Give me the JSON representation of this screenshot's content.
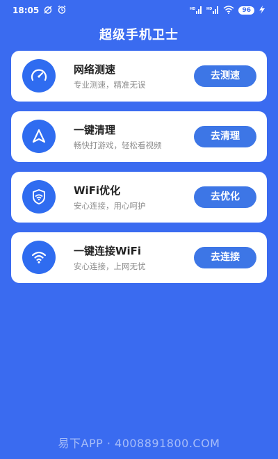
{
  "status_bar": {
    "time": "18:05",
    "icons_left": [
      "alarm-off-icon",
      "alarm-clock-icon"
    ],
    "signal_label": "HD",
    "battery": "96"
  },
  "header": {
    "title": "超级手机卫士"
  },
  "cards": [
    {
      "title": "网络测速",
      "subtitle": "专业测速，精准无误",
      "button": "去测速",
      "icon": "speedometer-icon"
    },
    {
      "title": "一键清理",
      "subtitle": "畅快打游戏，轻松看视频",
      "button": "去清理",
      "icon": "navigation-arrow-icon"
    },
    {
      "title": "WiFi优化",
      "subtitle": "安心连接，用心呵护",
      "button": "去优化",
      "icon": "shield-wifi-icon"
    },
    {
      "title": "一键连接WiFi",
      "subtitle": "安心连接，上网无忧",
      "button": "去连接",
      "icon": "wifi-icon"
    }
  ],
  "watermark": "易下APP · 4008891800.COM",
  "colors": {
    "background": "#3a6bf0",
    "button": "#3d76e6",
    "icon_circle": "#2f6cf0"
  }
}
